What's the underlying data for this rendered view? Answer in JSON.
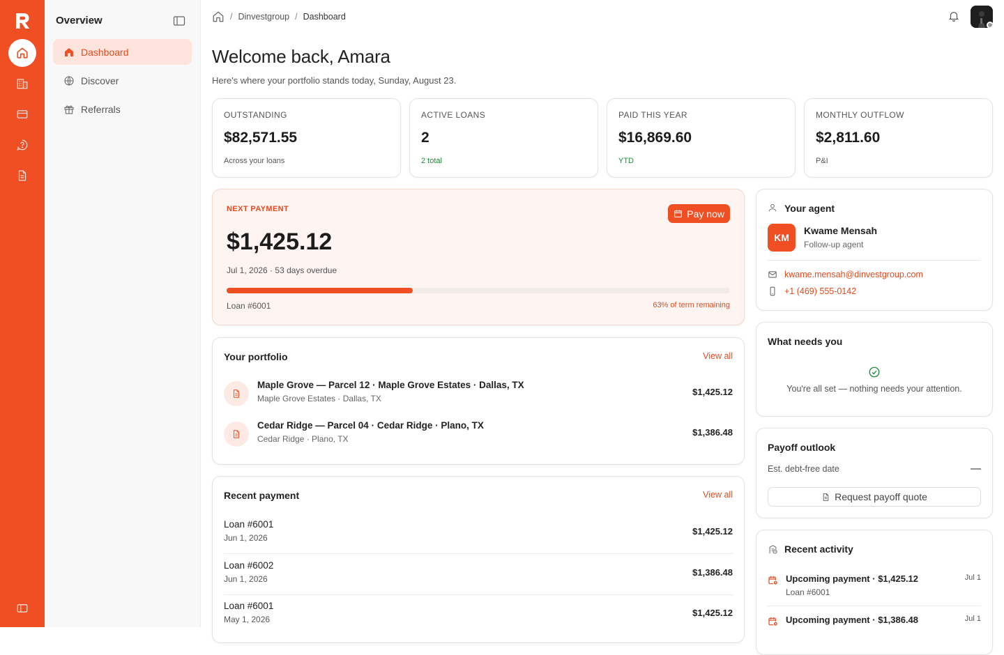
{
  "rail": {
    "items": [
      {
        "icon": "home-icon"
      },
      {
        "icon": "building-icon"
      },
      {
        "icon": "card-icon"
      },
      {
        "icon": "help-icon"
      },
      {
        "icon": "document-icon"
      }
    ],
    "footer_icon": "panel-toggle-icon"
  },
  "sidebar": {
    "title": "Overview",
    "items": [
      {
        "label": "Dashboard",
        "icon": "home-icon",
        "active": true
      },
      {
        "label": "Discover",
        "icon": "globe-icon"
      },
      {
        "label": "Referrals",
        "icon": "gift-icon"
      }
    ]
  },
  "breadcrumb": {
    "org": "Dinvestgroup",
    "page": "Dashboard"
  },
  "header": {
    "title": "Welcome back, Amara",
    "subtitle": "Here's where your portfolio stands today, Sunday, August 23."
  },
  "stats": [
    {
      "label": "OUTSTANDING",
      "value": "$82,571.55",
      "note": "Across your loans"
    },
    {
      "label": "ACTIVE LOANS",
      "value": "2",
      "note": "2 total"
    },
    {
      "label": "PAID THIS YEAR",
      "value": "$16,869.60",
      "note": "YTD"
    },
    {
      "label": "MONTHLY OUTFLOW",
      "value": "$2,811.60",
      "note": "P&I"
    }
  ],
  "next_payment": {
    "label": "NEXT PAYMENT",
    "amount": "$1,425.12",
    "date": "Jul 1, 2026",
    "status": "53 days overdue",
    "progress": 0.37,
    "loan": "Loan #6001",
    "remaining": "63% of term remaining",
    "pay_label": "Pay now"
  },
  "portfolio": {
    "title": "Your portfolio",
    "view_all": "View all",
    "items": [
      {
        "name": "Maple Grove — Parcel 12",
        "community": "Maple Grove Estates",
        "city": "Dallas, TX",
        "amount": "$1,425.12"
      },
      {
        "name": "Cedar Ridge — Parcel 04",
        "community": "Cedar Ridge",
        "city": "Plano, TX",
        "amount": "$1,386.48"
      }
    ]
  },
  "recent_payment": {
    "title": "Recent payment",
    "view_all": "View all",
    "items": [
      {
        "loan": "Loan #6001",
        "date": "Jun 1, 2026",
        "amount": "$1,425.12"
      },
      {
        "loan": "Loan #6002",
        "date": "Jun 1, 2026",
        "amount": "$1,386.48"
      },
      {
        "loan": "Loan #6001",
        "date": "May 1, 2026",
        "amount": "$1,425.12"
      }
    ]
  },
  "agent": {
    "title": "Your agent",
    "initials": "KM",
    "name": "Kwame Mensah",
    "role": "Follow-up agent",
    "email": "kwame.mensah@dinvestgroup.com",
    "phone": "+1 (469) 555-0142"
  },
  "needs": {
    "title": "What needs you",
    "message": "You're all set — nothing needs your attention."
  },
  "payoff": {
    "title": "Payoff outlook",
    "label": "Est. debt-free date",
    "value": "—",
    "button": "Request payoff quote"
  },
  "activity": {
    "title": "Recent activity",
    "items": [
      {
        "title": "Upcoming payment",
        "amount": "$1,425.12",
        "sub": "Loan #6001",
        "date": "Jul 1"
      },
      {
        "title": "Upcoming payment",
        "amount": "$1,386.48",
        "sub": "",
        "date": "Jul 1"
      }
    ]
  },
  "colors": {
    "brand": "#f04e23",
    "brand_soft": "#fde5dd",
    "success": "#1f8a3a"
  }
}
